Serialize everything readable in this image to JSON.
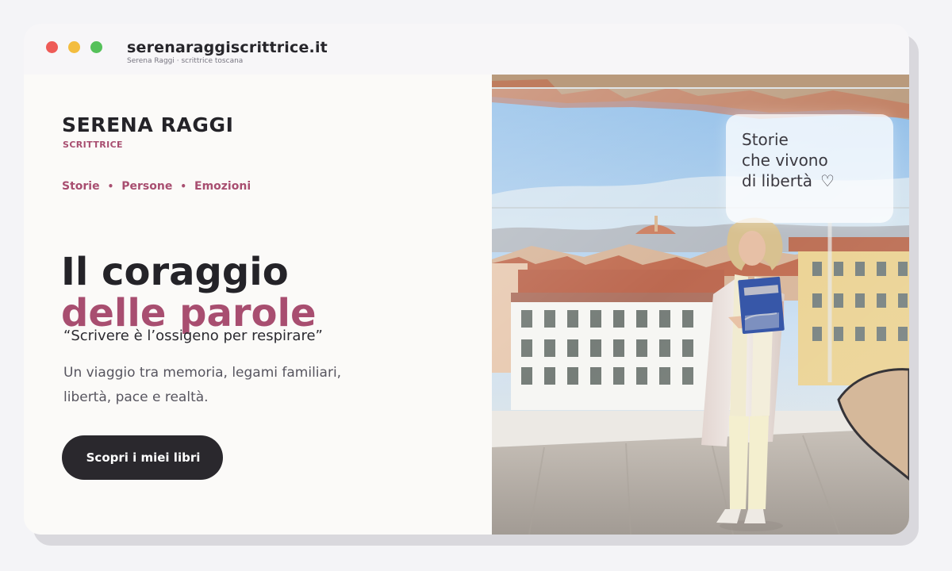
{
  "window": {
    "site_title": "serenaraggiscrittrice.it",
    "site_subtitle": "Serena Raggi · scrittrice toscana",
    "controls": [
      "close",
      "minimize",
      "maximize"
    ]
  },
  "branding": {
    "name": "SERENA RAGGI",
    "role": "SCRITTRICE"
  },
  "navigation": {
    "items": [
      "Storie",
      "Persone",
      "Emozioni"
    ],
    "separator": "•"
  },
  "hero": {
    "headline_line1": "Il coraggio",
    "headline_line2": "delle parole",
    "quote": "“Scrivere è l’ossigeno per respirare”",
    "description_line1": "Un viaggio tra memoria, legami familiari,",
    "description_line2": "libertà, pace e realtà.",
    "cta_label": "Scopri i miei libri"
  },
  "photo_card": {
    "line1": "Storie",
    "line2": "che vivono",
    "line3": "di libertà",
    "icon": "heart-icon"
  },
  "colors": {
    "accent": "#a84e70",
    "dark": "#242328",
    "button": "#2a282d",
    "window_red": "#ee5b57",
    "window_yellow": "#f3bd3f",
    "window_green": "#55c15a"
  }
}
